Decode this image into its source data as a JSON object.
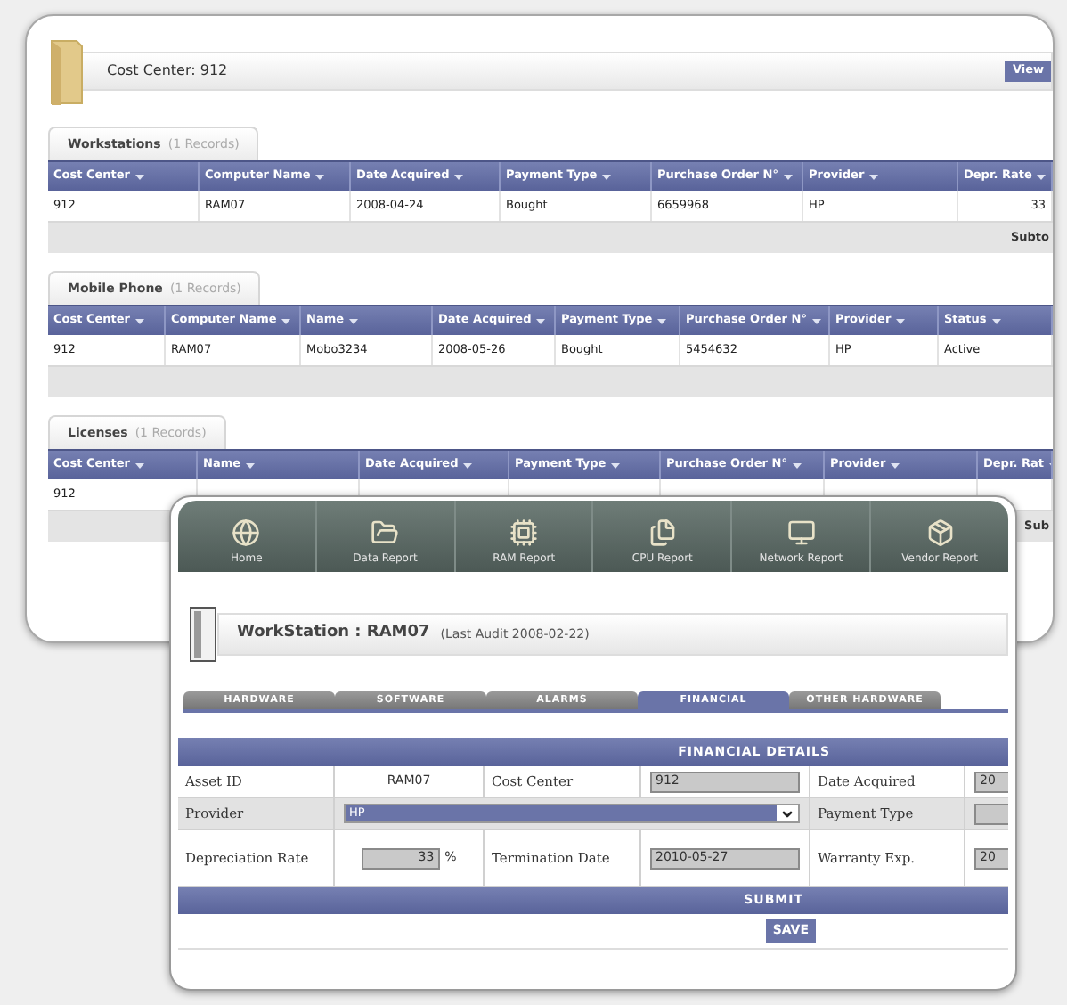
{
  "back_window": {
    "title": "Cost Center: 912",
    "view_button": "View",
    "sections": [
      {
        "title": "Workstations",
        "count": "(1 Records)",
        "columns": [
          "Cost Center",
          "Computer Name",
          "Date Acquired",
          "Payment Type",
          "Purchase Order N°",
          "Provider",
          "Depr. Rate"
        ],
        "rows": [
          [
            "912",
            "RAM07",
            "2008-04-24",
            "Bought",
            "6659968",
            "HP",
            "33"
          ]
        ],
        "subtotal": "Subto"
      },
      {
        "title": "Mobile Phone",
        "count": "(1 Records)",
        "columns": [
          "Cost Center",
          "Computer Name",
          "Name",
          "Date Acquired",
          "Payment Type",
          "Purchase Order N°",
          "Provider",
          "Status"
        ],
        "rows": [
          [
            "912",
            "RAM07",
            "Mobo3234",
            "2008-05-26",
            "Bought",
            "5454632",
            "HP",
            "Active"
          ]
        ]
      },
      {
        "title": "Licenses",
        "count": "(1 Records)",
        "columns": [
          "Cost Center",
          "Name",
          "Date Acquired",
          "Payment Type",
          "Purchase Order N°",
          "Provider",
          "Depr. Rat"
        ],
        "rows": [
          [
            "912"
          ]
        ],
        "subtotal": "Sub"
      }
    ]
  },
  "front_window": {
    "nav": [
      {
        "label": "Home",
        "kind": "globe"
      },
      {
        "label": "Data Report",
        "kind": "folder"
      },
      {
        "label": "RAM Report",
        "kind": "chip"
      },
      {
        "label": "CPU Report",
        "kind": "documents"
      },
      {
        "label": "Network Report",
        "kind": "monitor"
      },
      {
        "label": "Vendor Report",
        "kind": "package"
      }
    ],
    "title": "WorkStation : RAM07",
    "subtitle": "(Last Audit 2008-02-22)",
    "tabs": [
      {
        "label": "HARDWARE",
        "selected": false
      },
      {
        "label": "SOFTWARE",
        "selected": false
      },
      {
        "label": "ALARMS",
        "selected": false
      },
      {
        "label": "FINANCIAL",
        "selected": true
      },
      {
        "label": "OTHER HARDWARE",
        "selected": false
      }
    ],
    "section_title": "FINANCIAL DETAILS",
    "form_rows": [
      [
        {
          "kind": "label",
          "text": "Asset ID"
        },
        {
          "kind": "text",
          "text": "RAM07"
        },
        {
          "kind": "label",
          "text": "Cost Center"
        },
        {
          "kind": "input",
          "value": "912"
        },
        {
          "kind": "label",
          "text": "Date Acquired"
        },
        {
          "kind": "input",
          "value": "20"
        }
      ],
      [
        {
          "kind": "label",
          "text": "Provider"
        },
        {
          "kind": "select",
          "value": "HP"
        },
        {
          "kind": "label",
          "text": "Payment Type"
        },
        {
          "kind": "input"
        }
      ],
      [
        {
          "kind": "label",
          "text": "Depreciation Rate"
        },
        {
          "kind": "percent",
          "value": "33",
          "unit": "%"
        },
        {
          "kind": "label",
          "text": "Termination Date"
        },
        {
          "kind": "input",
          "value": "2010-05-27"
        },
        {
          "kind": "label",
          "text": "Warranty Exp."
        },
        {
          "kind": "input",
          "value": "20"
        }
      ]
    ],
    "submit_title": "SUBMIT",
    "save_button": "SAVE"
  }
}
